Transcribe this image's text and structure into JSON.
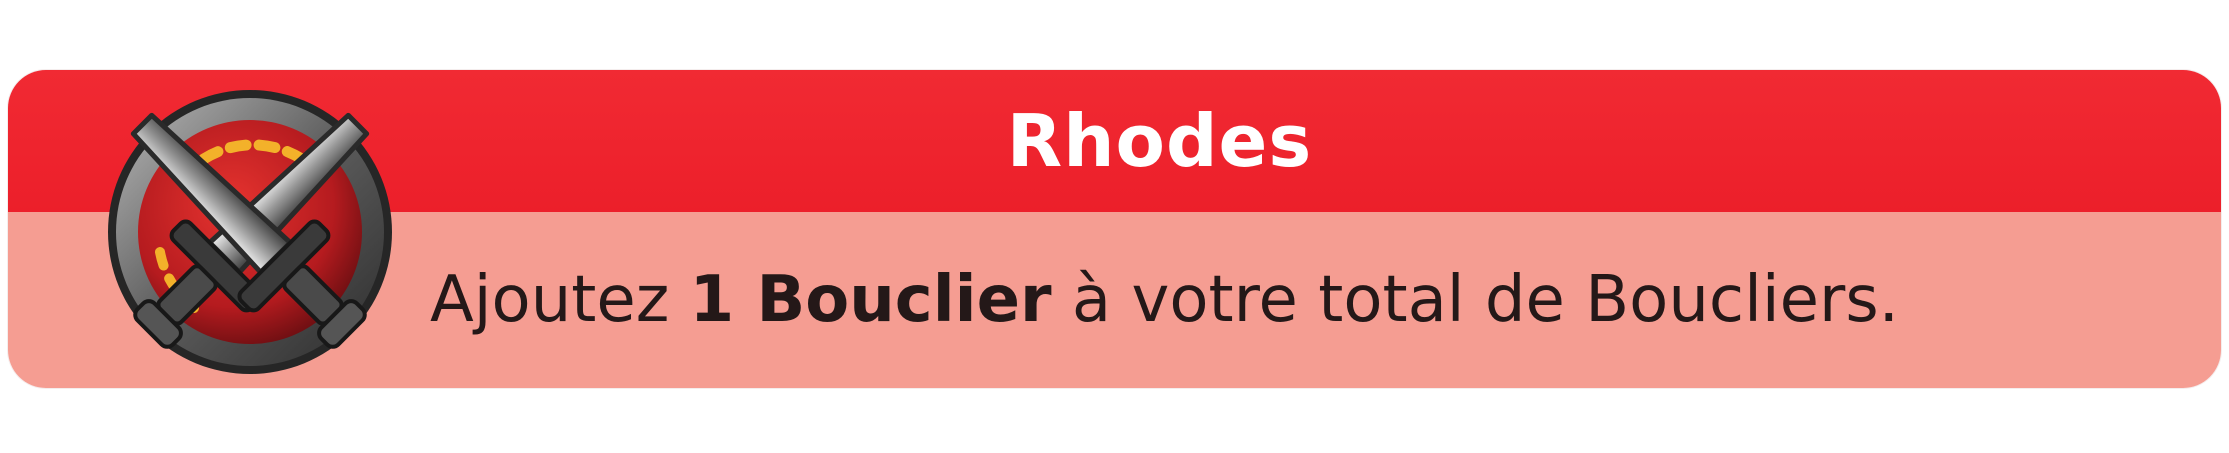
{
  "card": {
    "title": "Rhodes",
    "effect": {
      "before": "Ajoutez ",
      "highlight": "1 Bouclier",
      "after": " à votre total de Boucliers."
    },
    "badge_icon": "crossed-swords-icon"
  },
  "colors": {
    "header": "#ee2430",
    "body": "#f59d92",
    "title_text": "#ffffff",
    "effect_text": "#241818"
  }
}
